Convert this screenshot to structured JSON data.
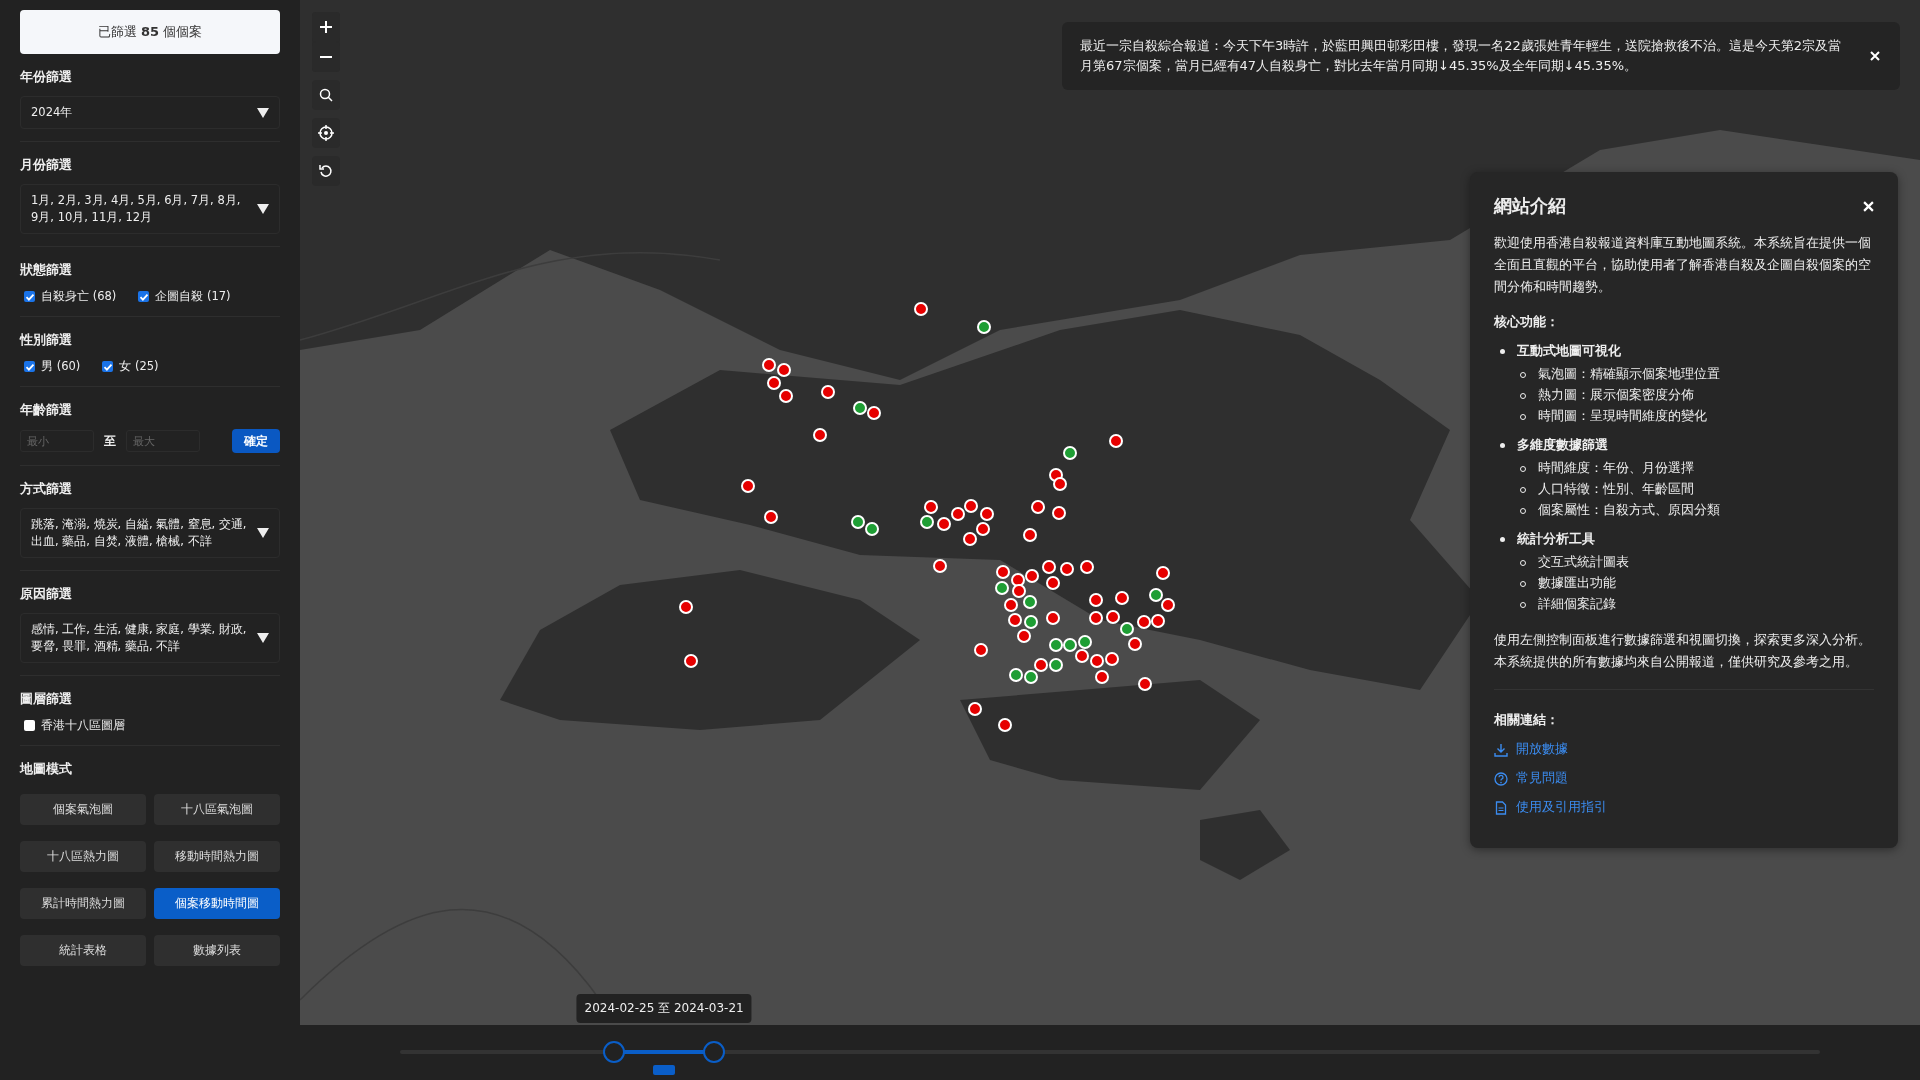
{
  "summary": "已篩選 **85** 個個案",
  "filters": [
    {
      "kind": "select",
      "title": "年份篩選",
      "value": "2024年"
    },
    {
      "kind": "select",
      "title": "月份篩選",
      "value": "1月, 2月, 3月, 4月, 5月, 6月, 7月, 8月, 9月, 10月, 11月, 12月"
    },
    {
      "kind": "checks",
      "title": "狀態篩選",
      "options": [
        {
          "label": "自殺身亡 (68)",
          "checked": true
        },
        {
          "label": "企圖自殺 (17)",
          "checked": true
        }
      ]
    },
    {
      "kind": "checks",
      "title": "性別篩選",
      "options": [
        {
          "label": "男 (60)",
          "checked": true
        },
        {
          "label": "女 (25)",
          "checked": true
        }
      ]
    },
    {
      "kind": "range",
      "title": "年齡篩選",
      "min": {
        "placeholder": "最小"
      },
      "separator": "至",
      "max": {
        "placeholder": "最大"
      },
      "button": "確定"
    },
    {
      "kind": "select",
      "title": "方式篩選",
      "value": "跳落, 淹溺, 燒炭, 自縊, 氣體, 窒息, 交通, 出血, 藥品, 自焚, 液體, 槍械, 不詳"
    },
    {
      "kind": "select",
      "title": "原因篩選",
      "value": "感情, 工作, 生活, 健康, 家庭, 學業, 財政, 要脅, 畏罪, 酒精, 藥品, 不詳"
    },
    {
      "kind": "checks",
      "title": "圖層篩選",
      "options": [
        {
          "label": "香港十八區圖層",
          "checked": false
        }
      ]
    }
  ],
  "map_mode": {
    "title": "地圖模式",
    "buttons": [
      {
        "label": "個案氣泡圖",
        "selected": false
      },
      {
        "label": "十八區氣泡圖",
        "selected": false
      },
      {
        "label": "十八區熱力圖",
        "selected": false
      },
      {
        "label": "移動時間熱力圖",
        "selected": false
      },
      {
        "label": "累計時間熱力圖",
        "selected": false
      },
      {
        "label": "個案移動時間圖",
        "selected": true
      },
      {
        "label": "統計表格",
        "selected": false
      },
      {
        "label": "數據列表",
        "selected": false
      }
    ]
  },
  "markers": [
    {
      "color": "#e60000"
    },
    {
      "color": "#1e9e34"
    },
    {
      "color": "#e60000"
    },
    {
      "color": "#e60000"
    },
    {
      "color": "#e60000"
    },
    {
      "color": "#e60000"
    },
    {
      "color": "#e60000"
    },
    {
      "color": "#1e9e34"
    },
    {
      "color": "#e60000"
    },
    {
      "color": "#e60000"
    },
    {
      "color": "#1e9e34"
    },
    {
      "color": "#e60000"
    },
    {
      "color": "#e60000"
    },
    {
      "color": "#e60000"
    },
    {
      "color": "#e60000"
    },
    {
      "color": "#e60000"
    },
    {
      "color": "#e60000"
    },
    {
      "color": "#1e9e34"
    },
    {
      "color": "#e60000"
    },
    {
      "color": "#e60000"
    },
    {
      "color": "#e60000"
    },
    {
      "color": "#e60000"
    },
    {
      "color": "#e60000"
    },
    {
      "color": "#e60000"
    },
    {
      "color": "#e60000"
    },
    {
      "color": "#e60000"
    },
    {
      "color": "#e60000"
    },
    {
      "color": "#1e9e34"
    },
    {
      "color": "#1e9e34"
    },
    {
      "color": "#e60000"
    },
    {
      "color": "#e60000"
    },
    {
      "color": "#e60000"
    },
    {
      "color": "#e60000"
    },
    {
      "color": "#e60000"
    },
    {
      "color": "#e60000"
    },
    {
      "color": "#e60000"
    },
    {
      "color": "#e60000"
    },
    {
      "color": "#e60000"
    },
    {
      "color": "#1e9e34"
    },
    {
      "color": "#e60000"
    },
    {
      "color": "#1e9e34"
    },
    {
      "color": "#e60000"
    },
    {
      "color": "#e60000"
    },
    {
      "color": "#e60000"
    },
    {
      "color": "#1e9e34"
    },
    {
      "color": "#e60000"
    },
    {
      "color": "#e60000"
    },
    {
      "color": "#e60000"
    },
    {
      "color": "#1e9e34"
    },
    {
      "color": "#e60000"
    },
    {
      "color": "#e60000"
    },
    {
      "color": "#e60000"
    },
    {
      "color": "#e60000"
    },
    {
      "color": "#e60000"
    },
    {
      "color": "#1e9e34"
    },
    {
      "color": "#e60000"
    },
    {
      "color": "#e60000"
    },
    {
      "color": "#e60000"
    },
    {
      "color": "#e60000"
    },
    {
      "color": "#e60000"
    },
    {
      "color": "#e60000"
    },
    {
      "color": "#e60000"
    },
    {
      "color": "#1e9e34"
    },
    {
      "color": "#1e9e34"
    },
    {
      "color": "#1e9e34"
    },
    {
      "color": "#e60000"
    },
    {
      "color": "#1e9e34"
    },
    {
      "color": "#1e9e34"
    },
    {
      "color": "#1e9e34"
    },
    {
      "color": "#e60000"
    },
    {
      "color": "#e60000"
    },
    {
      "color": "#e60000"
    },
    {
      "color": "#e60000"
    }
  ],
  "notification": {
    "text": "最近一宗自殺綜合報道：今天下午3時許，於藍田興田邨彩田樓，發現一名22歲張姓青年輕生，送院搶救後不治。這是今天第2宗及當月第67宗個案，當月已經有47人自殺身亡，對比去年當月同期↓45.35%及全年同期↓45.35%。"
  },
  "info_panel": {
    "title": "網站介紹",
    "intro": "歡迎使用香港自殺報道資料庫互動地圖系統。本系統旨在提供一個全面且直觀的平台，協助使用者了解香港自殺及企圖自殺個案的空間分佈和時間趨勢。",
    "core_title": "核心功能：",
    "features": [
      {
        "title": "互動式地圖可視化",
        "items": [
          "氣泡圖：精確顯示個案地理位置",
          "熱力圖：展示個案密度分佈",
          "時間圖：呈現時間維度的變化"
        ]
      },
      {
        "title": "多維度數據篩選",
        "items": [
          "時間維度：年份、月份選擇",
          "人口特徵：性別、年齡區間",
          "個案屬性：自殺方式、原因分類"
        ]
      },
      {
        "title": "統計分析工具",
        "items": [
          "交互式統計圖表",
          "數據匯出功能",
          "詳細個案記錄"
        ]
      }
    ],
    "footer": "使用左側控制面板進行數據篩選和視圖切換，探索更多深入分析。本系統提供的所有數據均來自公開報道，僅供研究及參考之用。",
    "links_title": "相關連結：",
    "links": [
      {
        "kind": "download",
        "label": "開放數據"
      },
      {
        "kind": "help",
        "label": "常見問題"
      },
      {
        "kind": "document",
        "label": "使用及引用指引"
      }
    ]
  },
  "timeline": {
    "label": "2024-02-25 至 2024-03-21",
    "handles": [
      {
        "level": 0.151
      },
      {
        "level": 0.221
      }
    ]
  }
}
